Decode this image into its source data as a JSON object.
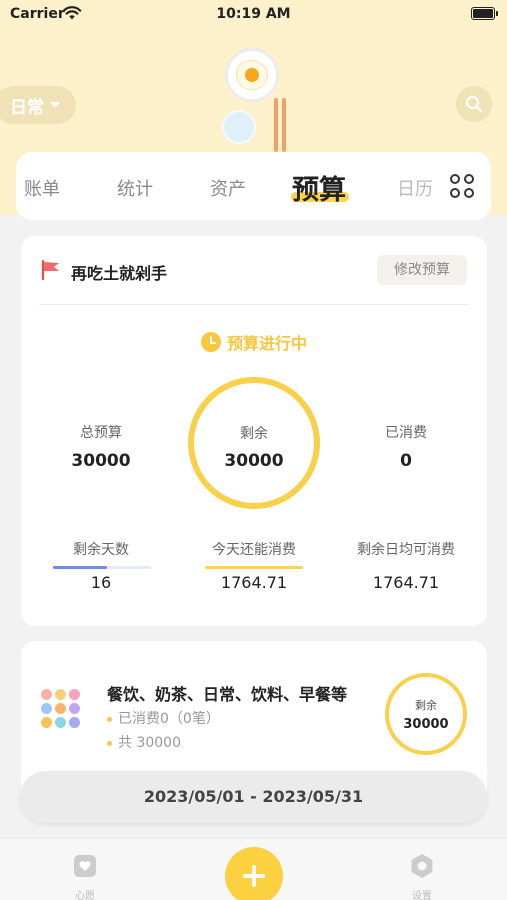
{
  "status_bar": {
    "carrier": "Carrier",
    "time": "10:19 AM"
  },
  "header": {
    "book_name": "日常"
  },
  "tabs": [
    {
      "label": "账单"
    },
    {
      "label": "统计"
    },
    {
      "label": "资产"
    },
    {
      "label": "预算",
      "active": true
    },
    {
      "label": "日历"
    }
  ],
  "budget": {
    "name": "再吃土就剁手",
    "modify_label": "修改预算",
    "status": "预算进行中",
    "total_label": "总预算",
    "total_value": "30000",
    "remaining_label": "剩余",
    "remaining_value": "30000",
    "spent_label": "已消费",
    "spent_value": "0",
    "days_left_label": "剩余天数",
    "days_left_value": "16",
    "days_left_progress": 0.55,
    "today_label": "今天还能消费",
    "today_value": "1764.71",
    "daily_avg_label": "剩余日均可消费",
    "daily_avg_value": "1764.71"
  },
  "category_budget": {
    "title": "餐饮、奶茶、日常、饮料、早餐等",
    "spent_line": "已消费0（0笔）",
    "total_line": "共 30000",
    "remaining_label": "剩余",
    "remaining_value": "30000"
  },
  "date_range": "2023/05/01 - 2023/05/31",
  "bottom_nav": {
    "wish_label": "心愿",
    "settings_label": "设置"
  },
  "colors": {
    "accent": "#fbd44a",
    "header": "#fdf1cc",
    "progress": "#6d8ee4"
  }
}
